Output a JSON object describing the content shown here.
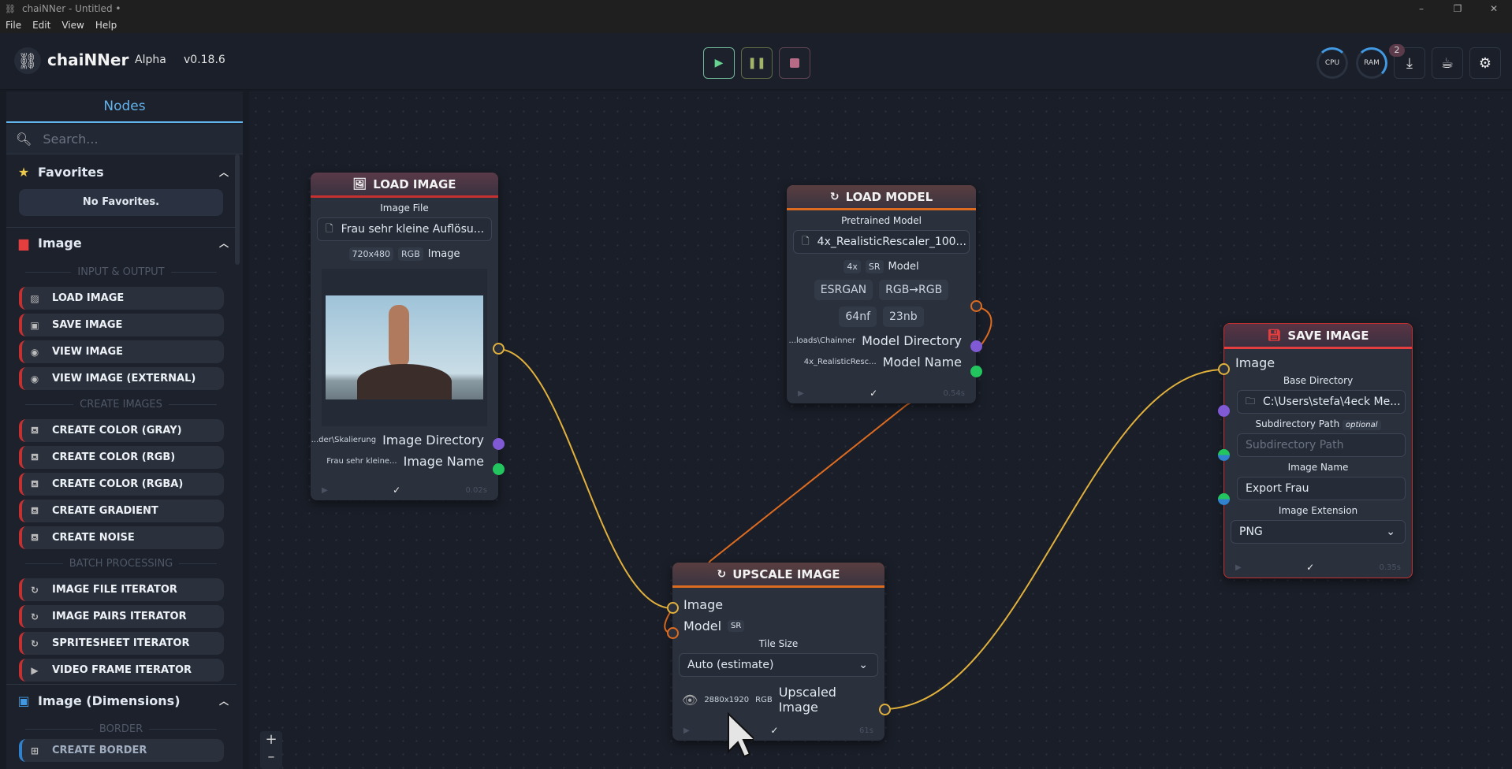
{
  "window": {
    "title": "chaiNNer - Untitled •",
    "controls": [
      "–",
      "❐",
      "✕"
    ]
  },
  "menu": [
    "File",
    "Edit",
    "View",
    "Help"
  ],
  "header": {
    "app_name": "chaiNNer",
    "channel": "Alpha",
    "version": "v0.18.6",
    "cpu_label": "CPU",
    "ram_label": "RAM",
    "download_badge": "2",
    "run_color": "#68d391",
    "pause_color": "#a3b46a",
    "stop_color": "#b56b86"
  },
  "sidebar": {
    "tab": "Nodes",
    "search_placeholder": "Search...",
    "favorites": {
      "title": "Favorites",
      "empty": "No Favorites."
    },
    "image": {
      "title": "Image",
      "groups": [
        {
          "name": "INPUT & OUTPUT",
          "items": [
            {
              "label": "LOAD IMAGE",
              "icon": "image-icon"
            },
            {
              "label": "SAVE IMAGE",
              "icon": "save-icon"
            },
            {
              "label": "VIEW IMAGE",
              "icon": "eye-icon"
            },
            {
              "label": "VIEW IMAGE (EXTERNAL)",
              "icon": "eye-icon"
            }
          ]
        },
        {
          "name": "CREATE IMAGES",
          "items": [
            {
              "label": "CREATE COLOR (GRAY)",
              "icon": "paint-bucket-icon"
            },
            {
              "label": "CREATE COLOR (RGB)",
              "icon": "paint-bucket-icon"
            },
            {
              "label": "CREATE COLOR (RGBA)",
              "icon": "paint-bucket-icon"
            },
            {
              "label": "CREATE GRADIENT",
              "icon": "paint-bucket-icon"
            },
            {
              "label": "CREATE NOISE",
              "icon": "paint-bucket-icon"
            }
          ]
        },
        {
          "name": "BATCH PROCESSING",
          "items": [
            {
              "label": "IMAGE FILE ITERATOR",
              "icon": "loop-icon"
            },
            {
              "label": "IMAGE PAIRS ITERATOR",
              "icon": "loop-icon"
            },
            {
              "label": "SPRITESHEET ITERATOR",
              "icon": "loop-icon"
            },
            {
              "label": "VIDEO FRAME ITERATOR",
              "icon": "video-icon"
            }
          ]
        }
      ]
    },
    "image_dimensions": {
      "title": "Image (Dimensions)",
      "group": "BORDER",
      "item": "CREATE BORDER"
    }
  },
  "nodes": {
    "load_image": {
      "title": "LOAD IMAGE",
      "file_label": "Image File",
      "file_value": "Frau sehr kleine Auflösu...",
      "dims": "720x480",
      "channels": "RGB",
      "output_image": "Image",
      "dir_value": "...der\\Skalierung",
      "dir_label": "Image Directory",
      "name_value": "Frau sehr kleine...",
      "name_label": "Image Name",
      "time": "0.02s"
    },
    "load_model": {
      "title": "LOAD MODEL",
      "model_label": "Pretrained Model",
      "model_value": "4x_RealisticRescaler_100...",
      "scale": "4x",
      "kind": "SR",
      "output_model": "Model",
      "arch": "ESRGAN",
      "color": "RGB→RGB",
      "nf": "64nf",
      "nb": "23nb",
      "dir_value": "...loads\\Chainner",
      "dir_label": "Model Directory",
      "name_value": "4x_RealisticResc...",
      "name_label": "Model Name",
      "time": "0.54s"
    },
    "upscale": {
      "title": "UPSCALE IMAGE",
      "input_image": "Image",
      "input_model": "Model",
      "model_tag": "SR",
      "tile_label": "Tile Size",
      "tile_value": "Auto (estimate)",
      "dims": "2880x1920",
      "channels": "RGB",
      "output": "Upscaled Image",
      "time": "61s"
    },
    "save_image": {
      "title": "SAVE IMAGE",
      "input_image": "Image",
      "base_label": "Base Directory",
      "base_value": "C:\\Users\\stefa\\4eck Me...",
      "sub_label": "Subdirectory Path",
      "sub_optional": "optional",
      "sub_placeholder": "Subdirectory Path",
      "name_label": "Image Name",
      "name_value": "Export Frau",
      "ext_label": "Image Extension",
      "ext_value": "PNG",
      "time": "0.35s"
    }
  },
  "colors": {
    "image_edge": "#e1b13c",
    "model_edge": "#dd6b20",
    "directory_port": "#805ad5",
    "string_port": "#22c55e"
  }
}
